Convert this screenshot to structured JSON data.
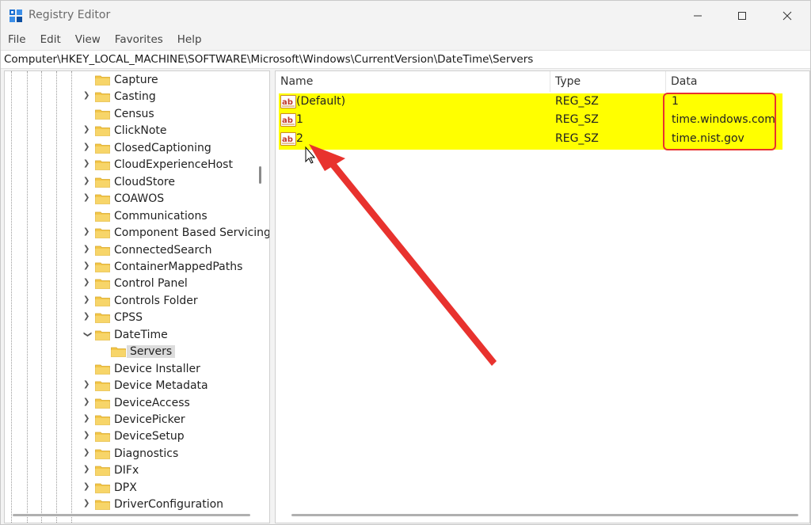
{
  "window": {
    "title": "Registry Editor",
    "icons": {
      "app": "registry-editor-icon",
      "minimize": "minimize-icon",
      "maximize": "maximize-icon",
      "close": "close-icon"
    }
  },
  "menu": [
    "File",
    "Edit",
    "View",
    "Favorites",
    "Help"
  ],
  "address": "Computer\\HKEY_LOCAL_MACHINE\\SOFTWARE\\Microsoft\\Windows\\CurrentVersion\\DateTime\\Servers",
  "tree": {
    "items": [
      {
        "label": "Capture",
        "expander": "none"
      },
      {
        "label": "Casting",
        "expander": "collapsed"
      },
      {
        "label": "Census",
        "expander": "none"
      },
      {
        "label": "ClickNote",
        "expander": "collapsed"
      },
      {
        "label": "ClosedCaptioning",
        "expander": "collapsed"
      },
      {
        "label": "CloudExperienceHost",
        "expander": "collapsed"
      },
      {
        "label": "CloudStore",
        "expander": "collapsed"
      },
      {
        "label": "COAWOS",
        "expander": "collapsed"
      },
      {
        "label": "Communications",
        "expander": "none"
      },
      {
        "label": "Component Based Servicing",
        "expander": "collapsed"
      },
      {
        "label": "ConnectedSearch",
        "expander": "collapsed"
      },
      {
        "label": "ContainerMappedPaths",
        "expander": "collapsed"
      },
      {
        "label": "Control Panel",
        "expander": "collapsed"
      },
      {
        "label": "Controls Folder",
        "expander": "collapsed"
      },
      {
        "label": "CPSS",
        "expander": "collapsed"
      },
      {
        "label": "DateTime",
        "expander": "expanded"
      },
      {
        "label": "Servers",
        "expander": "child-selected"
      },
      {
        "label": "Device Installer",
        "expander": "none"
      },
      {
        "label": "Device Metadata",
        "expander": "collapsed"
      },
      {
        "label": "DeviceAccess",
        "expander": "collapsed"
      },
      {
        "label": "DevicePicker",
        "expander": "collapsed"
      },
      {
        "label": "DeviceSetup",
        "expander": "collapsed"
      },
      {
        "label": "Diagnostics",
        "expander": "collapsed"
      },
      {
        "label": "DIFx",
        "expander": "collapsed"
      },
      {
        "label": "DPX",
        "expander": "collapsed"
      },
      {
        "label": "DriverConfiguration",
        "expander": "collapsed"
      }
    ]
  },
  "list": {
    "columns": {
      "name": "Name",
      "type": "Type",
      "data": "Data"
    },
    "rows": [
      {
        "name": "(Default)",
        "type": "REG_SZ",
        "data": "1"
      },
      {
        "name": "1",
        "type": "REG_SZ",
        "data": "time.windows.com"
      },
      {
        "name": "2",
        "type": "REG_SZ",
        "data": "time.nist.gov"
      }
    ]
  },
  "colors": {
    "highlight": "#ffff00",
    "annotation_red": "#e8322e",
    "folder": "#f3c648",
    "selected": "#dcdcdc"
  }
}
